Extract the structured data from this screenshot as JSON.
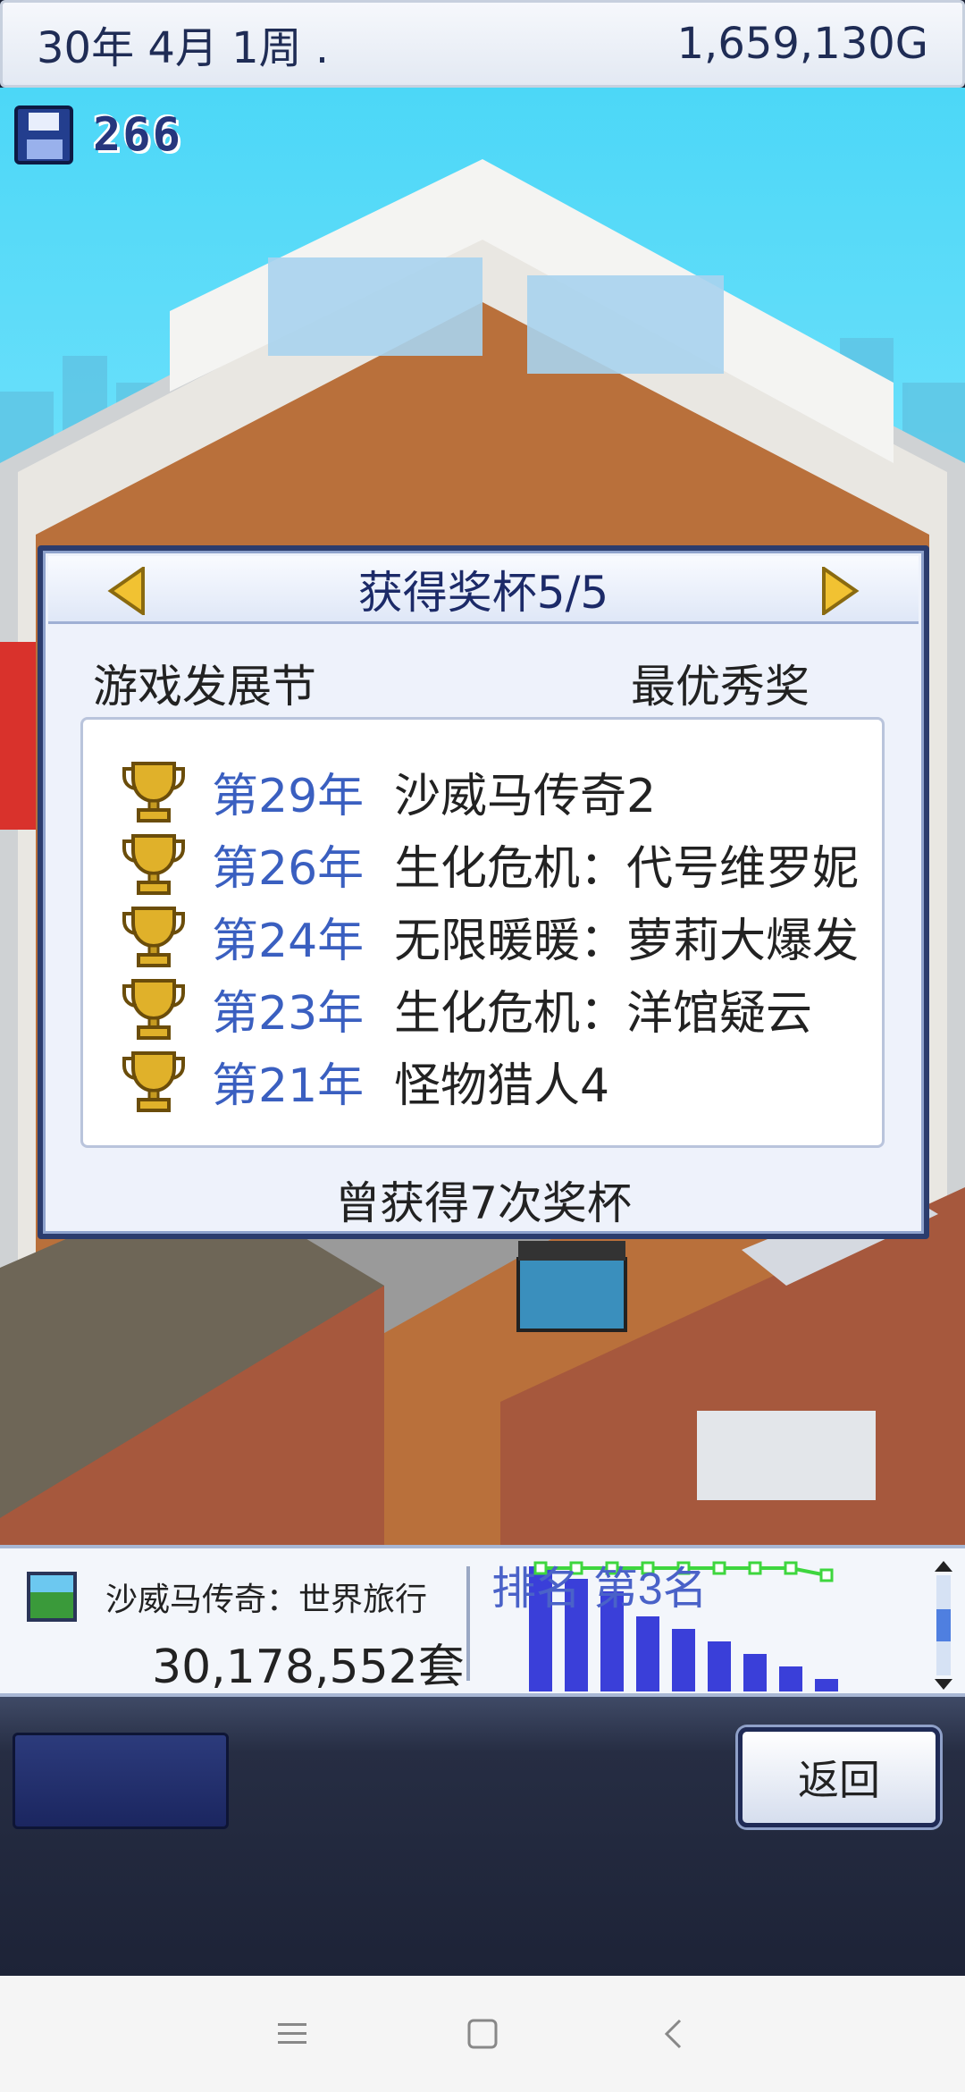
{
  "status": {
    "date": "30年 4月 1周 .",
    "money": "1,659,130G"
  },
  "save_counter": {
    "icon": "floppy-disk-icon",
    "count": "266"
  },
  "dialog": {
    "title": "获得奖杯5/5",
    "category": "游戏发展节",
    "award": "最优秀奖",
    "trophies": [
      {
        "year": "第29年",
        "name": "沙威马传奇2"
      },
      {
        "year": "第26年",
        "name": "生化危机：代号维罗妮"
      },
      {
        "year": "第24年",
        "name": "无限暖暖：萝莉大爆发"
      },
      {
        "year": "第23年",
        "name": "生化危机：洋馆疑云"
      },
      {
        "year": "第21年",
        "name": "怪物猎人4"
      }
    ],
    "footer": "曾获得7次奖杯"
  },
  "info_panel": {
    "game_name": "沙威马传奇：世界旅行",
    "sales": "30,178,552套",
    "ranking_label": "排名 第3名",
    "ranking_history": [
      10,
      9,
      8,
      6,
      5,
      4,
      3,
      2,
      1
    ],
    "colors": {
      "bars": "#3a3fd9",
      "line": "#3ed63e",
      "label": "#4a62c8"
    }
  },
  "controls": {
    "return_label": "返回"
  },
  "navbar": {
    "items": [
      "menu-icon",
      "home-square-icon",
      "back-chevron-icon"
    ]
  }
}
